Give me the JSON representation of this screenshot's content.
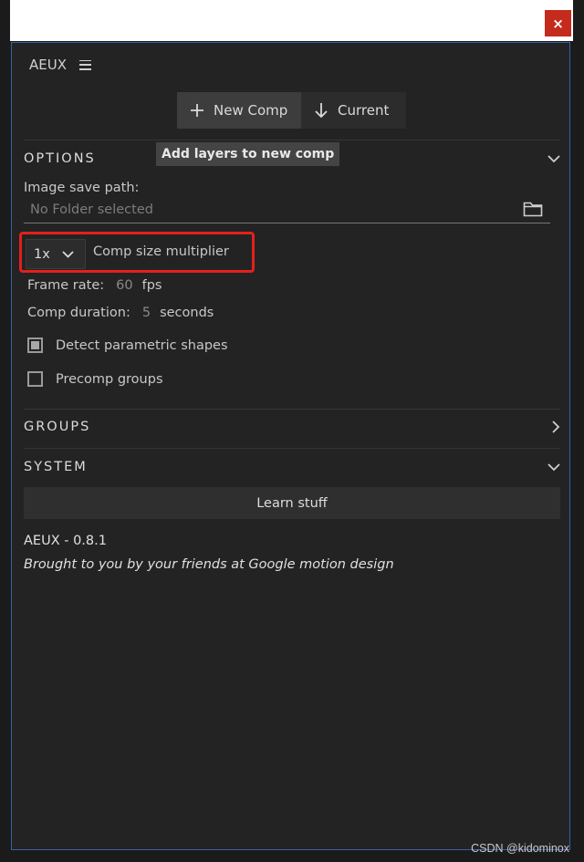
{
  "window": {
    "close_glyph": "×"
  },
  "panel": {
    "title": "AEUX",
    "menu_icon": "hamburger-menu-icon"
  },
  "toolbar": {
    "new_comp_label": "New Comp",
    "new_comp_icon": "plus-icon",
    "current_label": "Current",
    "current_icon": "arrow-down-icon",
    "tooltip": "Add layers to new comp"
  },
  "options": {
    "header": "OPTIONS",
    "image_save_path_label": "Image save path:",
    "image_save_path_value": "No Folder selected",
    "multiplier_value": "1x",
    "multiplier_label": "Comp size multiplier",
    "frame_rate_label": "Frame rate:",
    "frame_rate_value": "60",
    "frame_rate_unit": "fps",
    "comp_duration_label": "Comp duration:",
    "comp_duration_value": "5",
    "comp_duration_unit": "seconds",
    "detect_shapes_label": "Detect parametric shapes",
    "detect_shapes_checked": true,
    "precomp_groups_label": "Precomp groups",
    "precomp_groups_checked": false
  },
  "groups": {
    "header": "GROUPS"
  },
  "system": {
    "header": "SYSTEM",
    "learn_label": "Learn stuff",
    "version": "AEUX - 0.8.1",
    "credit": "Brought to you by your friends at Google motion design"
  },
  "watermark": "CSDN @kidominox",
  "colors": {
    "panel_bg": "#232323",
    "panel_border": "#3a5ea8",
    "close_red": "#c42b1c",
    "highlight_red": "#e3201b"
  }
}
